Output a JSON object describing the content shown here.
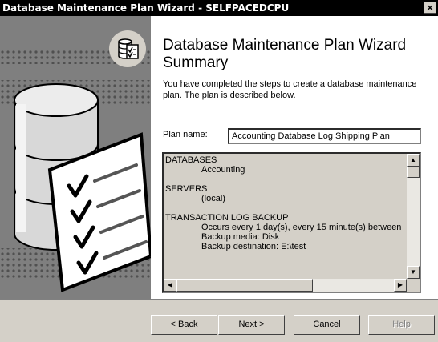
{
  "window": {
    "title": "Database Maintenance Plan Wizard - SELFPACEDCPU",
    "close_glyph": "×"
  },
  "header": {
    "title_line1": "Database Maintenance Plan Wizard",
    "title_line2": "Summary",
    "description": "You have completed the steps to create a database maintenance plan. The plan is described below."
  },
  "plan": {
    "label": "Plan name:",
    "value": "Accounting Database Log Shipping Plan"
  },
  "summary": {
    "sections": [
      {
        "title": "DATABASES",
        "items": [
          "Accounting"
        ]
      },
      {
        "title": "SERVERS",
        "items": [
          "(local)"
        ]
      },
      {
        "title": "TRANSACTION LOG BACKUP",
        "items": [
          "Occurs every 1 day(s), every 15 minute(s) between",
          "Backup media: Disk",
          "Backup destination: E:\\test"
        ]
      }
    ]
  },
  "buttons": {
    "back": "< Back",
    "next": "Next >",
    "cancel": "Cancel",
    "help": "Help"
  },
  "icons": {
    "titlebar_close": "close-icon",
    "wizard": "database-check-icon",
    "illustration": "checklist-icon",
    "scroll_up": "scroll-up-arrow",
    "scroll_down": "scroll-down-arrow",
    "scroll_left": "scroll-left-arrow",
    "scroll_right": "scroll-right-arrow"
  },
  "colors": {
    "titlebar": "#000000",
    "face": "#d4d0c8",
    "content": "#ffffff"
  }
}
